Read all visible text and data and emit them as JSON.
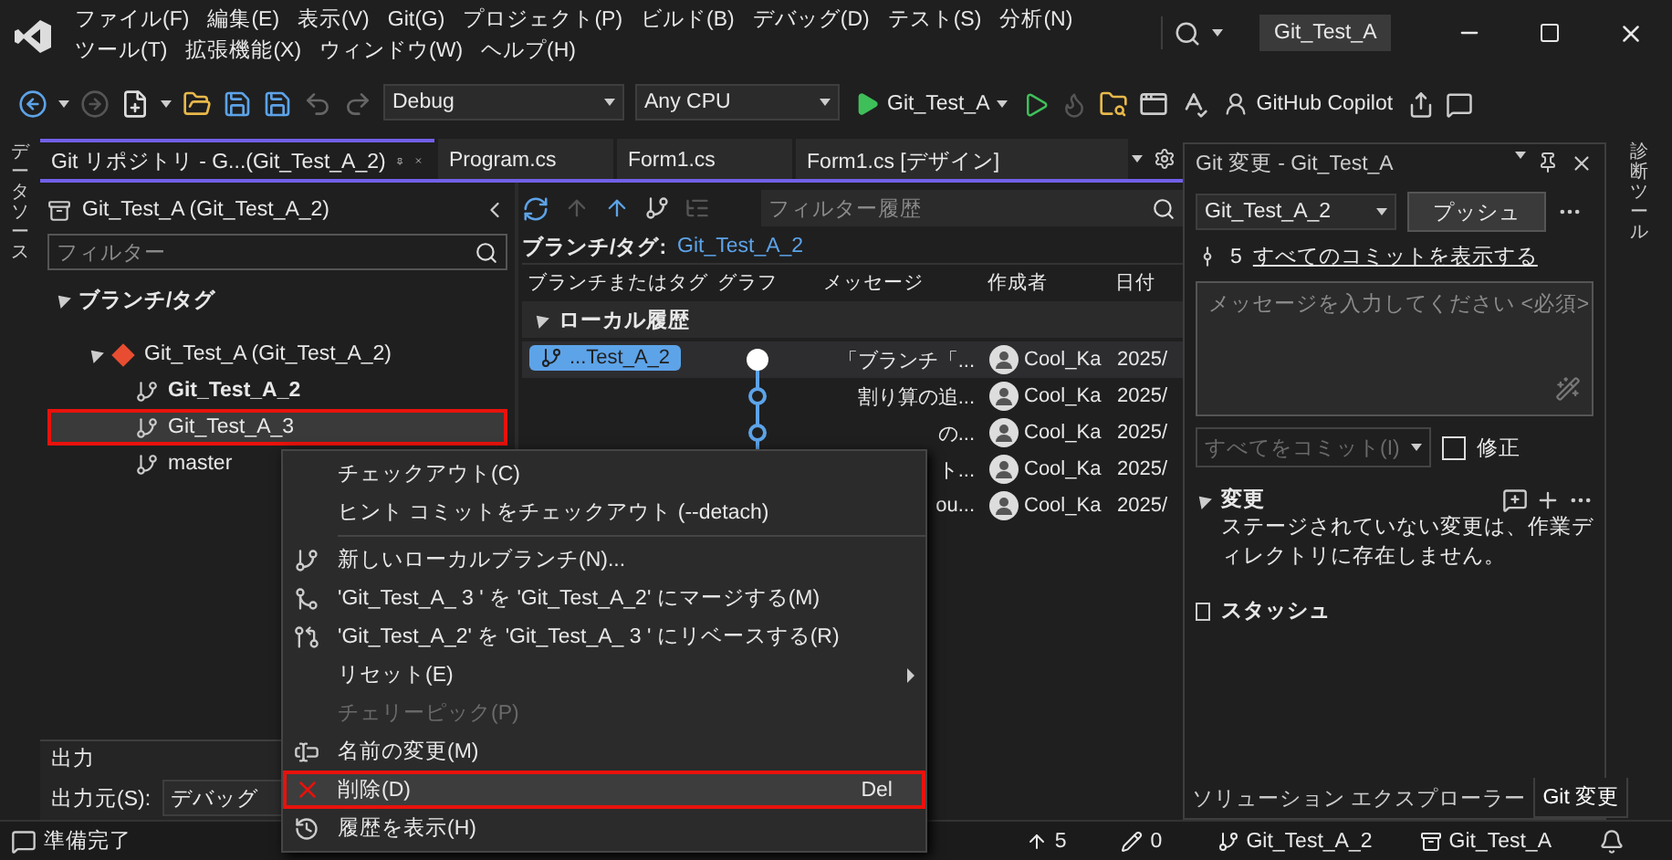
{
  "menu_bar": {
    "items": [
      "ファイル(F)",
      "編集(E)",
      "表示(V)",
      "Git(G)",
      "プロジェクト(P)",
      "ビルド(B)",
      "デバッグ(D)",
      "テスト(S)",
      "分析(N)",
      "ツール(T)",
      "拡張機能(X)",
      "ウィンドウ(W)",
      "ヘルプ(H)"
    ],
    "solution_name": "Git_Test_A"
  },
  "toolbar": {
    "configuration": "Debug",
    "platform": "Any CPU",
    "start_target": "Git_Test_A",
    "copilot": "GitHub Copilot"
  },
  "left_strip": {
    "label": "データソース"
  },
  "tabs": [
    {
      "label": "Git リポジトリ - G...(Git_Test_A_2)",
      "selected": true
    },
    {
      "label": "Program.cs",
      "selected": false
    },
    {
      "label": "Form1.cs",
      "selected": false
    },
    {
      "label": "Form1.cs [デザイン]",
      "selected": false
    }
  ],
  "repository": {
    "title": "Git_Test_A (Git_Test_A_2)",
    "filter_placeholder": "フィルター",
    "tree": [
      {
        "kind": "group",
        "label": "ブランチ/タグ",
        "expanded": true,
        "children": [
          {
            "kind": "repo",
            "label": "Git_Test_A (Git_Test_A_2)",
            "expanded": true,
            "children": [
              {
                "kind": "branch",
                "label": "Git_Test_A_2",
                "current": true,
                "selected": false,
                "outlined": false
              },
              {
                "kind": "branch",
                "label": "Git_Test_A_3",
                "current": false,
                "selected": true,
                "outlined": true
              },
              {
                "kind": "branch",
                "label": "master",
                "current": false,
                "selected": false,
                "outlined": false
              }
            ]
          }
        ]
      }
    ]
  },
  "output": {
    "title": "出力",
    "source_label": "出力元(S):",
    "source": "デバッグ"
  },
  "history": {
    "filter_placeholder": "フィルター履歴",
    "branch_label": "ブランチ/タグ:",
    "branch": "Git_Test_A_2",
    "columns": [
      "ブランチまたはタグ",
      "グラフ",
      "メッセージ",
      "作成者",
      "日付"
    ],
    "group": {
      "label": "ローカル履歴",
      "expanded": true
    },
    "rows": [
      {
        "tag": "...Test_A_2",
        "message": "「ブランチ「...",
        "author": "Cool_Ka",
        "date": "2025/",
        "selected": true
      },
      {
        "message": "割り算の追...",
        "author": "Cool_Ka",
        "date": "2025/",
        "selected": false
      },
      {
        "message": "の...",
        "author": "Cool_Ka",
        "date": "2025/",
        "selected": false
      },
      {
        "message": "ト...",
        "author": "Cool_Ka",
        "date": "2025/",
        "selected": false
      },
      {
        "message": "ou...",
        "author": "Cool_Ka",
        "date": "2025/",
        "selected": false
      }
    ]
  },
  "context_menu": {
    "items": [
      {
        "kind": "item",
        "label": "チェックアウト(C)",
        "disabled": false,
        "selected": false,
        "outlined": false
      },
      {
        "kind": "item",
        "label": "ヒント コミットをチェックアウト (--detach)",
        "disabled": false,
        "selected": false,
        "outlined": false
      },
      {
        "kind": "separator"
      },
      {
        "kind": "item",
        "label": "新しいローカルブランチ(N)...",
        "disabled": false,
        "selected": false,
        "outlined": false
      },
      {
        "kind": "item",
        "label": "'Git_Test_A_ 3 ' を 'Git_Test_A_2' にマージする(M)",
        "disabled": false,
        "selected": false,
        "outlined": false
      },
      {
        "kind": "item",
        "label": "'Git_Test_A_2' を 'Git_Test_A_ 3 ' にリベースする(R)",
        "disabled": false,
        "selected": false,
        "outlined": false
      },
      {
        "kind": "item",
        "label": "リセット(E)",
        "disabled": false,
        "selected": false,
        "outlined": false,
        "submenu": true
      },
      {
        "kind": "item",
        "label": "チェリーピック(P)",
        "disabled": true,
        "selected": false,
        "outlined": false
      },
      {
        "kind": "item",
        "label": "名前の変更(M)",
        "disabled": false,
        "selected": false,
        "outlined": false
      },
      {
        "kind": "item",
        "label": "削除(D)",
        "shortcut": "Del",
        "disabled": false,
        "selected": true,
        "outlined": true
      },
      {
        "kind": "item",
        "label": "履歴を表示(H)",
        "disabled": false,
        "selected": false,
        "outlined": false
      }
    ]
  },
  "git_changes": {
    "title": "Git 変更 - Git_Test_A",
    "branch": "Git_Test_A_2",
    "push": "プッシュ",
    "outgoing": "5",
    "view_all": "すべてのコミットを表示する",
    "message_placeholder": "メッセージを入力してください <必須>",
    "commit": "すべてをコミット(I)",
    "commit_disabled": true,
    "amend": {
      "label": "修正",
      "checked": false
    },
    "sections": [
      {
        "label": "変更",
        "expanded": true,
        "text": "ステージされていない変更は、作業ディレクトリに存在しません。"
      },
      {
        "label": "スタッシュ",
        "expanded": false
      }
    ]
  },
  "right_strip": {
    "label": "診断ツール"
  },
  "bottom_tabs": [
    {
      "label": "ソリューション エクスプローラー",
      "selected": false
    },
    {
      "label": "Git 変更",
      "selected": true
    }
  ],
  "status_bar": {
    "text": "準備完了",
    "outgoing": "5",
    "pending": "0",
    "branch": "Git_Test_A_2",
    "repository": "Git_Test_A"
  }
}
